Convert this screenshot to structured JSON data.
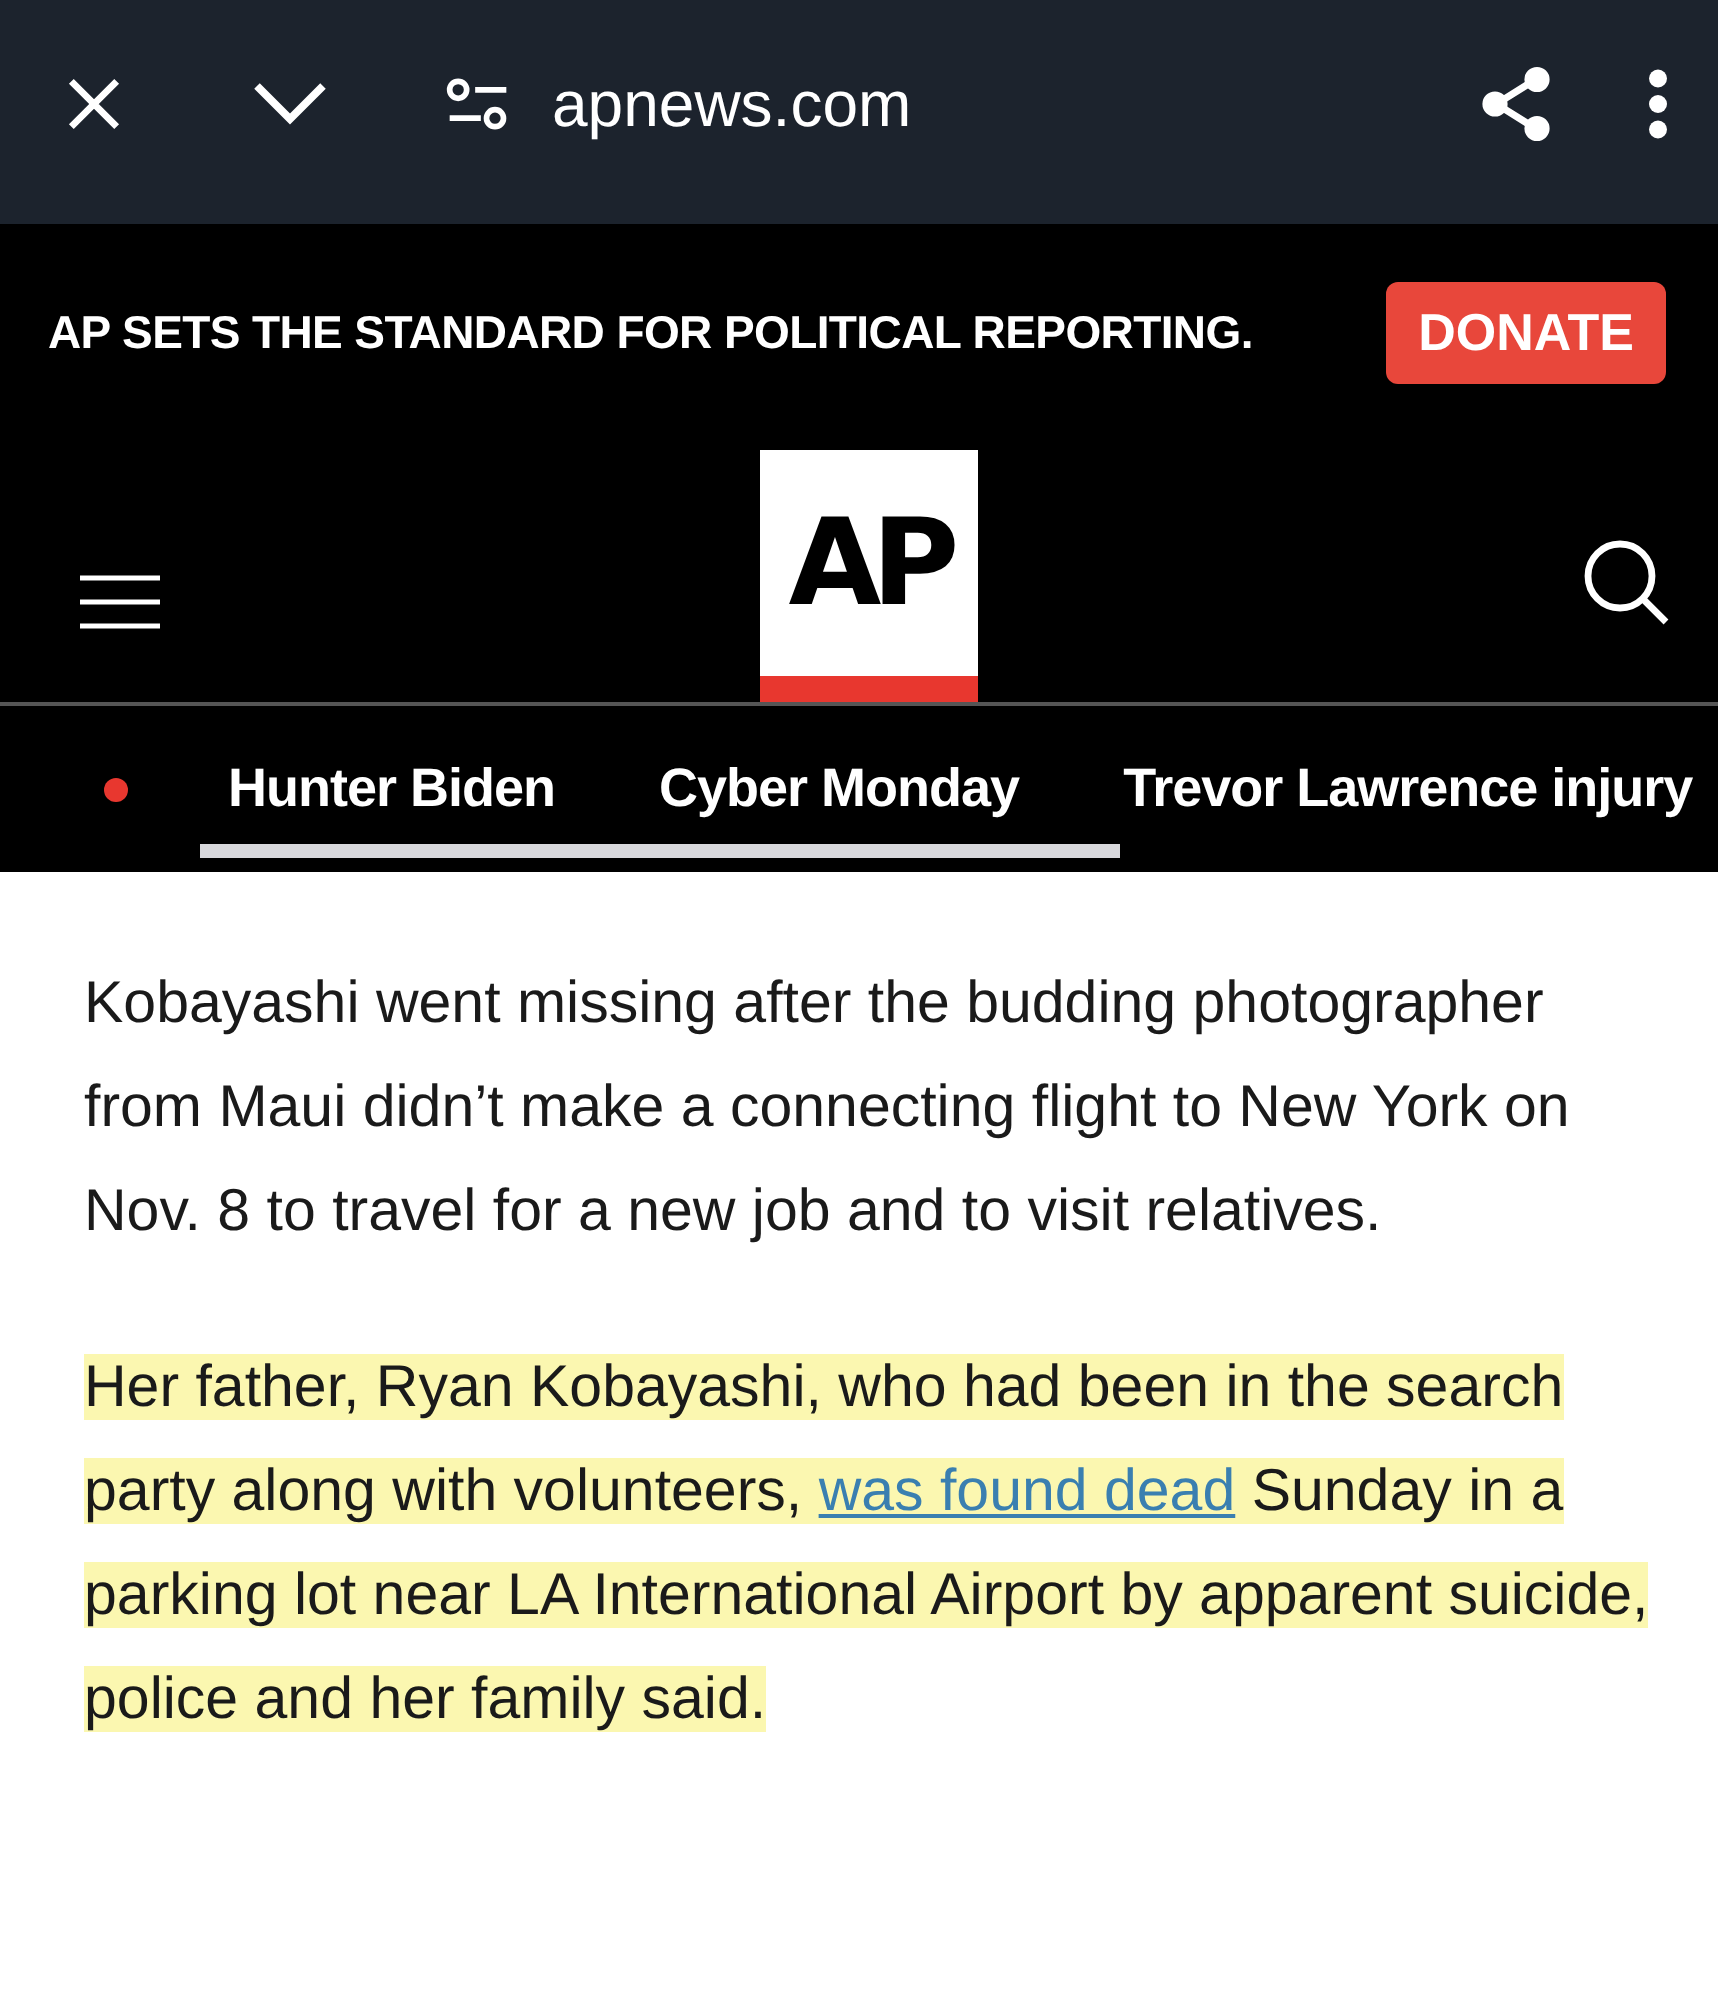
{
  "browser_bar": {
    "url": "apnews.com"
  },
  "banner": {
    "text": "AP SETS THE STANDARD FOR POLITICAL REPORTING.",
    "button": "DONATE"
  },
  "header": {
    "logo": "AP"
  },
  "trending": [
    {
      "label": "Hunter Biden"
    },
    {
      "label": "Cyber Monday"
    },
    {
      "label": "Trevor Lawrence injury"
    }
  ],
  "article": [
    {
      "highlighted": false,
      "parts": [
        {
          "kind": "text",
          "text": "Kobayashi went missing after the budding photographer from Maui didn’t make a connecting flight to New York on Nov. 8 to travel for a new job and to visit relatives."
        }
      ]
    },
    {
      "highlighted": true,
      "parts": [
        {
          "kind": "text",
          "text": "Her father, Ryan Kobayashi, who had been in the search party along with volunteers, "
        },
        {
          "kind": "link",
          "text": "was found dead"
        },
        {
          "kind": "text",
          "text": " Sunday in a parking lot near LA International Airport by apparent suicide, police and her family said."
        }
      ]
    }
  ]
}
